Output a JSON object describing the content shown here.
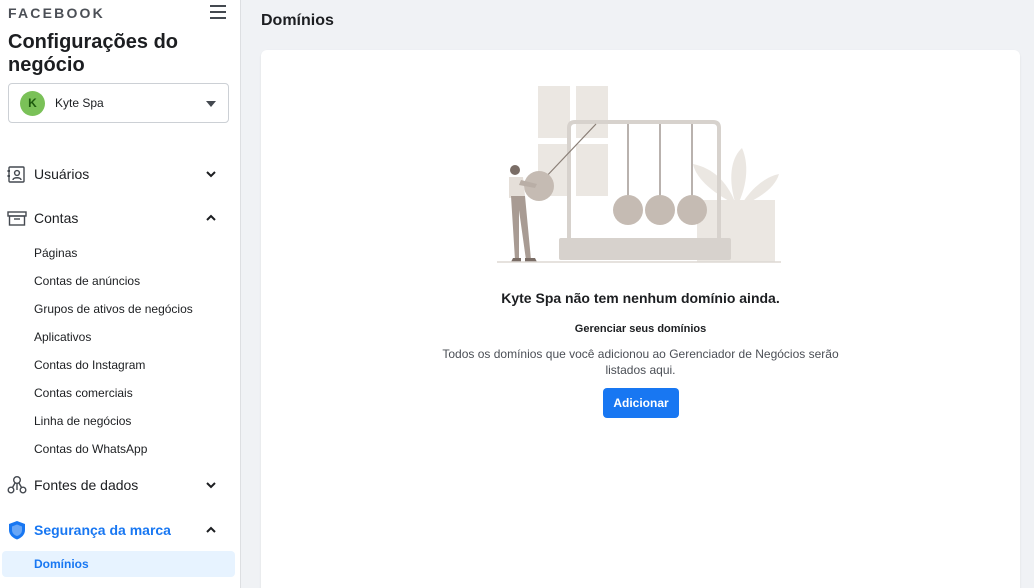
{
  "sidebar": {
    "brand": "FACEBOOK",
    "heading": "Configurações do negócio",
    "account": {
      "avatar_letter": "K",
      "name": "Kyte Spa"
    },
    "sections": {
      "users": {
        "label": "Usuários",
        "icon": "users-icon",
        "expanded": false
      },
      "accounts": {
        "label": "Contas",
        "icon": "archive-box-icon",
        "expanded": true
      },
      "data_sources": {
        "label": "Fontes de dados",
        "icon": "data-sources-icon",
        "expanded": false
      },
      "brand_safety": {
        "label": "Segurança da marca",
        "icon": "shield-icon",
        "expanded": true
      }
    },
    "account_items": [
      "Páginas",
      "Contas de anúncios",
      "Grupos de ativos de negócios",
      "Aplicativos",
      "Contas do Instagram",
      "Contas comerciais",
      "Linha de negócios",
      "Contas do WhatsApp"
    ],
    "brand_safety_items": [
      "Domínios"
    ]
  },
  "main": {
    "title": "Domínios",
    "empty_state": {
      "title": "Kyte Spa não tem nenhum domínio ainda.",
      "subtitle": "Gerenciar seus domínios",
      "description": "Todos os domínios que você adicionou ao Gerenciador de Negócios serão listados aqui.",
      "button_label": "Adicionar"
    }
  },
  "colors": {
    "accent": "#1877f2",
    "active_bg": "#e7f3ff",
    "avatar": "#7ac158",
    "background": "#f0f2f5"
  }
}
